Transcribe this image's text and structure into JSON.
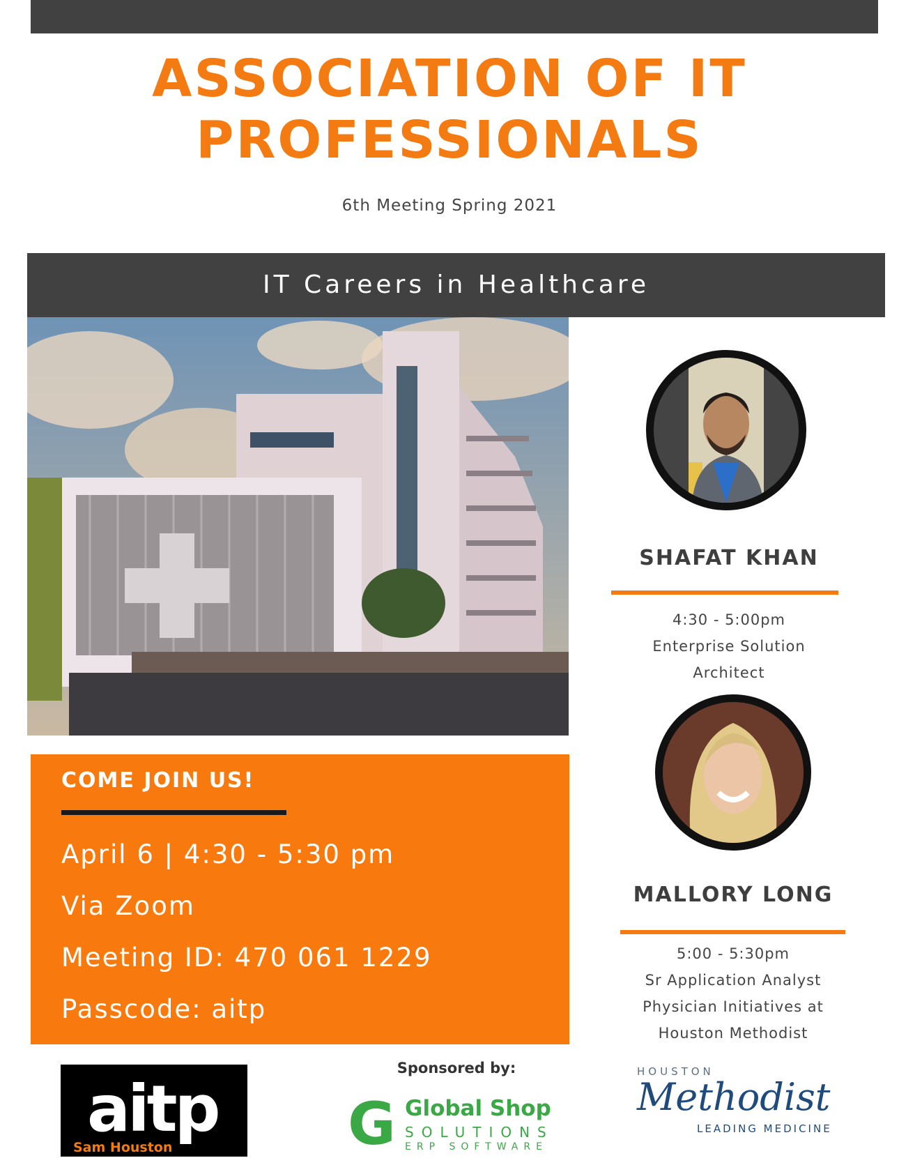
{
  "header": {
    "title_line1": "ASSOCIATION OF IT",
    "title_line2": "PROFESSIONALS",
    "subtitle": "6th Meeting Spring 2021"
  },
  "band": {
    "text": "IT Careers in Healthcare"
  },
  "join": {
    "heading": "COME JOIN US!",
    "date_time": "April 6 | 4:30 - 5:30 pm",
    "via": "Via Zoom",
    "meeting_id": "Meeting ID: 470 061 1229",
    "passcode": "Passcode: aitp"
  },
  "speakers": [
    {
      "name": "SHAFAT KHAN",
      "lines": [
        "4:30 - 5:00pm",
        "Enterprise Solution",
        "Architect"
      ]
    },
    {
      "name": "MALLORY LONG",
      "lines": [
        "5:00 - 5:30pm",
        "Sr Application Analyst",
        "Physician Initiatives at",
        "Houston Methodist"
      ]
    }
  ],
  "footer": {
    "sponsored_by": "Sponsored by:",
    "aitp_logo": {
      "main": "aitp",
      "sub": "Sam Houston"
    },
    "global_shop_logo": {
      "line1": "Global Shop",
      "line2": "SOLUTIONS",
      "line3": "ERP SOFTWARE"
    },
    "methodist_logo": {
      "top": "HOUSTON",
      "main": "Methodist",
      "bottom": "LEADING MEDICINE"
    }
  },
  "colors": {
    "orange": "#f8790e",
    "dark": "#414141"
  }
}
